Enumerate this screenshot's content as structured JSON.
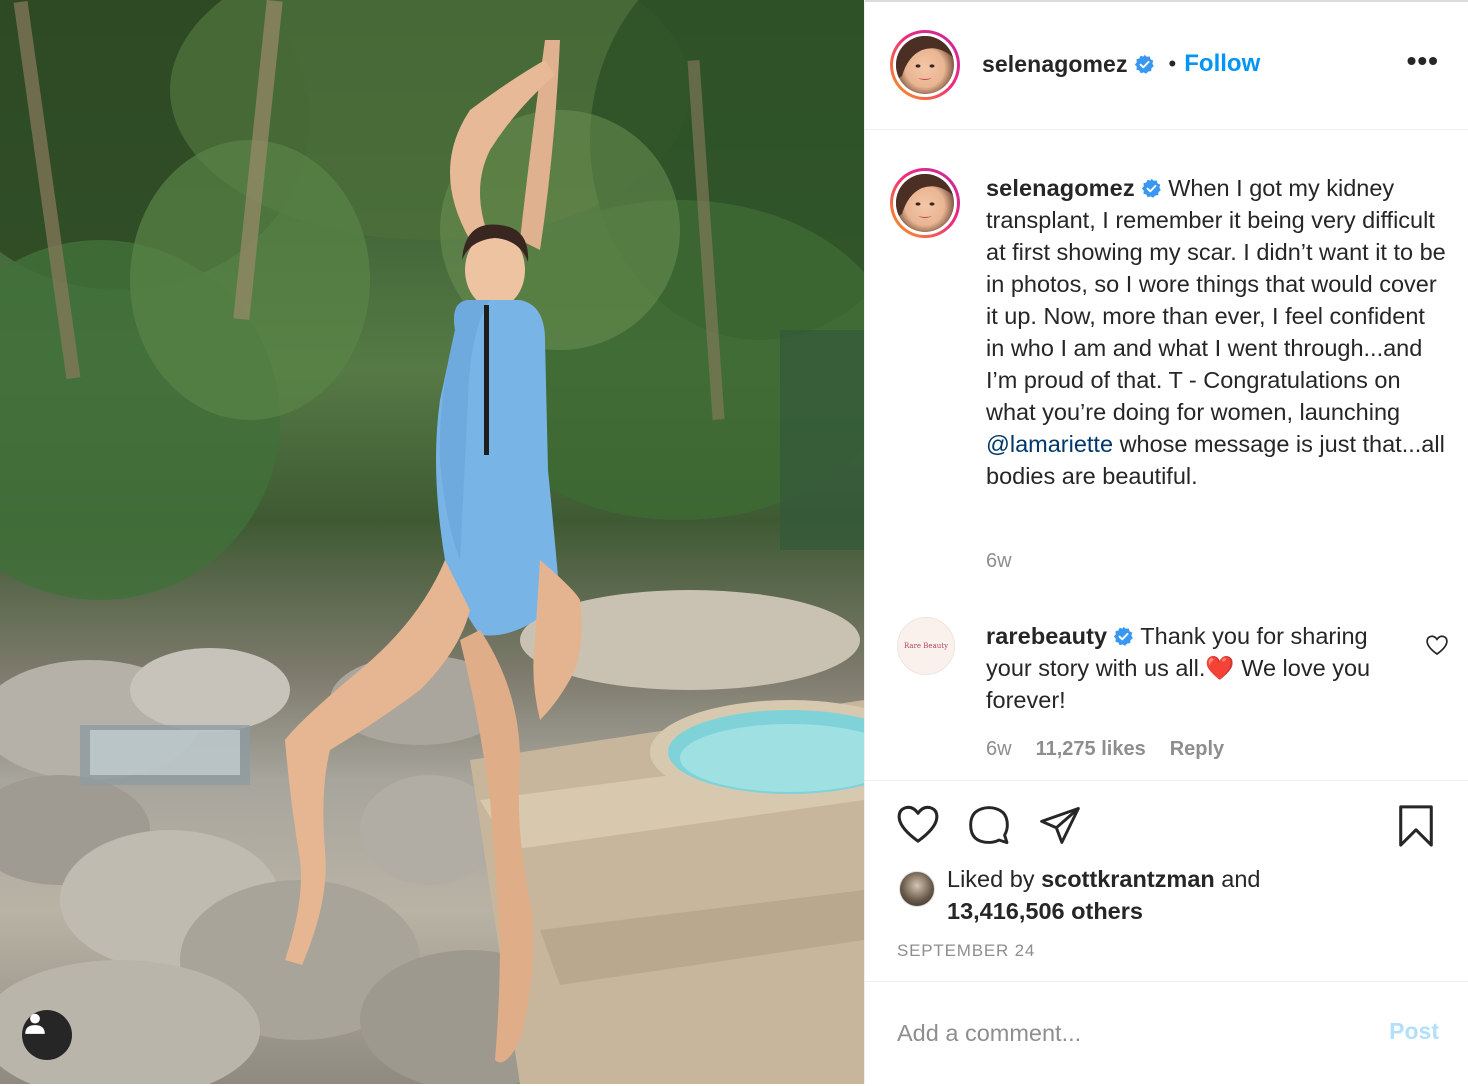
{
  "post": {
    "image_alt": "",
    "author": "selenagomez",
    "follow_label": "Follow",
    "dot": "•",
    "more_label": "•••"
  },
  "caption": {
    "username": "selenagomez",
    "text_before_mention": "When I got my kidney transplant, I remember it being very difficult at first showing my scar. I didn’t want it to be in photos, so I wore things that would cover it up. Now, more than ever, I feel confident in who I am and what I went through...and I’m proud of that. T - Congratulations on what you’re doing for women, launching ",
    "mention": "@lamariette",
    "text_after_mention": " whose message is just that...all bodies are beautiful.",
    "time": "6w"
  },
  "comment": {
    "avatar_text": "Rare Beauty",
    "username": "rarebeauty",
    "text": "Thank you for sharing your story with us all.❤️ We love you forever!",
    "time": "6w",
    "likes": "11,275 likes",
    "reply_label": "Reply"
  },
  "likes": {
    "prefix": "Liked by",
    "liker": "scottkrantzman",
    "and_label": "and",
    "others": "13,416,506 others"
  },
  "date": "SEPTEMBER 24",
  "add_comment": {
    "placeholder": "Add a comment...",
    "post_label": "Post"
  },
  "colors": {
    "accent": "#0095f6",
    "mention": "#00376b",
    "muted": "#8e8e8e",
    "post_disabled": "#b2dffc",
    "heart": "#ed4956"
  },
  "icons": [
    "verified-badge-icon",
    "more-options-icon",
    "heart-icon",
    "comment-icon",
    "share-icon",
    "bookmark-icon",
    "user-tag-icon"
  ]
}
